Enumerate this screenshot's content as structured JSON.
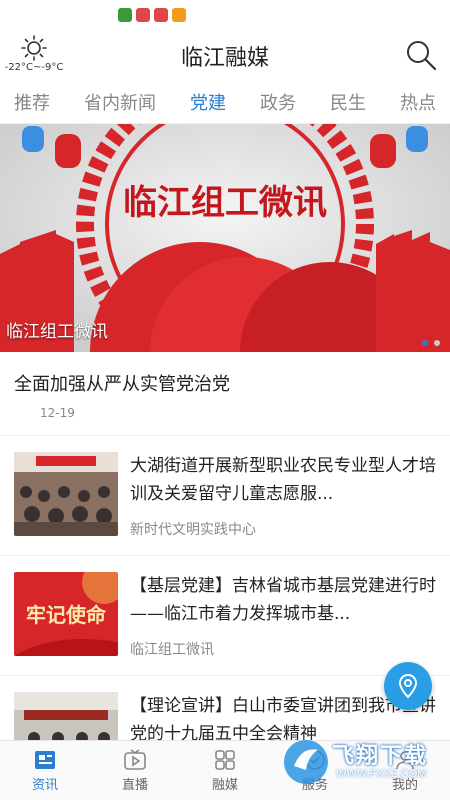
{
  "weather": {
    "text": "-22°C~-9°C",
    "icon": "sun-icon"
  },
  "app": {
    "title": "临江融媒"
  },
  "tabs": [
    {
      "label": "推荐"
    },
    {
      "label": "省内新闻"
    },
    {
      "label": "党建",
      "active": true
    },
    {
      "label": "政务"
    },
    {
      "label": "民生"
    },
    {
      "label": "热点"
    }
  ],
  "banner": {
    "image_title": "临江组工微讯",
    "caption": "临江组工微讯"
  },
  "headline": {
    "title": "全面加强从严从实管党治党",
    "date": "12-19"
  },
  "news": [
    {
      "title": "大湖街道开展新型职业农民专业型人才培训及关爱留守儿童志愿服...",
      "source": "新时代文明实践中心"
    },
    {
      "title": "【基层党建】吉林省城市基层党建进行时——临江市着力发挥城市基...",
      "source": "临江组工微讯",
      "thumb_text": "牢记使命"
    },
    {
      "title": "【理论宣讲】白山市委宣讲团到我市宣讲党的十九届五中全会精神",
      "source": ""
    }
  ],
  "bottom_nav": [
    {
      "label": "资讯",
      "icon": "news-icon",
      "active": true
    },
    {
      "label": "直播",
      "icon": "live-icon"
    },
    {
      "label": "融媒",
      "icon": "grid-icon"
    },
    {
      "label": "服务",
      "icon": "service-icon"
    },
    {
      "label": "我的",
      "icon": "profile-icon"
    }
  ],
  "watermark": {
    "title": "飞翔下载",
    "url": "WWW.FXXZ.COM"
  },
  "colors": {
    "accent": "#2a7fd4",
    "banner_red": "#d7262a"
  }
}
